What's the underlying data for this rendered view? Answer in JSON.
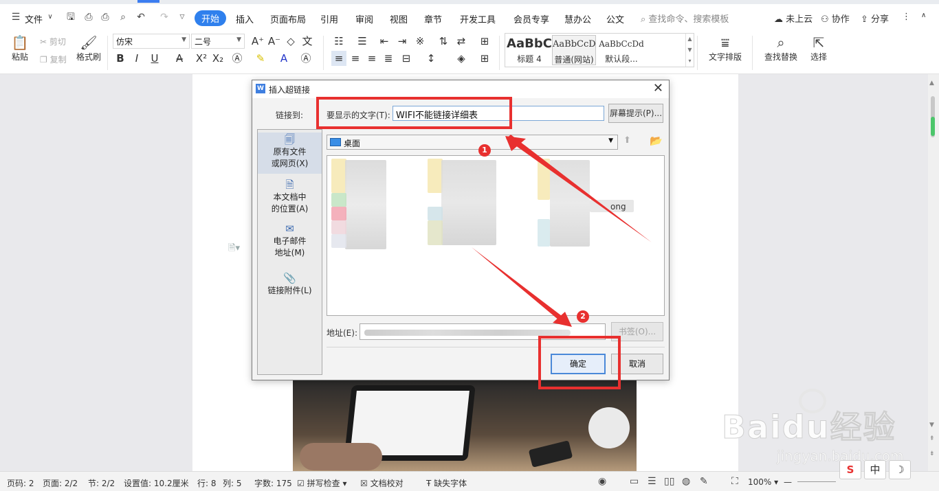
{
  "menubar": {
    "file_label": "文件",
    "tabs": [
      "开始",
      "插入",
      "页面布局",
      "引用",
      "审阅",
      "视图",
      "章节",
      "开发工具",
      "会员专享",
      "慧办公",
      "公文"
    ],
    "search_placeholder": "查找命令、搜索模板",
    "cloud_label": "未上云",
    "collab_label": "协作",
    "share_label": "分享"
  },
  "toolbar": {
    "paste_label": "粘贴",
    "cut_label": "剪切",
    "copy_label": "复制",
    "format_painter_label": "格式刷",
    "font_name": "仿宋",
    "font_size": "二号",
    "styles": [
      {
        "sample": "AaBbC",
        "name": "标题 4"
      },
      {
        "sample": "AaBbCcD",
        "name": "普通(网站)"
      },
      {
        "sample": "AaBbCcDd",
        "name": "默认段..."
      }
    ],
    "text_layout_label": "文字排版",
    "find_replace_label": "查找替换",
    "select_label": "选择"
  },
  "dialog": {
    "title": "插入超链接",
    "link_to_label": "链接到:",
    "display_text_label": "要显示的文字(T):",
    "display_text_value": "WIFI不能链接详细表",
    "screentip_label": "屏幕提示(P)...",
    "side_items": [
      {
        "line1": "原有文件",
        "line2": "或网页(X)",
        "icon": "file-web-icon"
      },
      {
        "line1": "本文档中",
        "line2": "的位置(A)",
        "icon": "document-place-icon"
      },
      {
        "line1": "电子邮件",
        "line2": "地址(M)",
        "icon": "email-icon"
      },
      {
        "line1": "链接附件(L)",
        "line2": "",
        "icon": "paperclip-icon"
      }
    ],
    "folder_value": "桌面",
    "visible_file_fragment": "ong",
    "address_label": "地址(E):",
    "bookmark_label": "书签(O)...",
    "ok_label": "确定",
    "cancel_label": "取消"
  },
  "annotations": {
    "badge1": "1",
    "badge2": "2",
    "color": "#e8302f"
  },
  "statusbar": {
    "page_num": "页码: 2",
    "pages": "页面: 2/2",
    "section": "节: 2/2",
    "setting": "设置值: 10.2厘米",
    "row": "行: 8",
    "col": "列: 5",
    "words": "字数: 175",
    "spellcheck": "拼写检查",
    "doc_check": "文档校对",
    "missing_font": "缺失字体",
    "zoom": "100%"
  },
  "watermark": {
    "brand": "Bai",
    "brand2": "du",
    "brand_cn": "经验",
    "url": "jingyan.baidu.com"
  },
  "ime": {
    "sogou": "S",
    "lang": "中",
    "moon": "☽"
  },
  "colors": {
    "accent": "#2f80ed",
    "annotation_red": "#e8302f"
  }
}
